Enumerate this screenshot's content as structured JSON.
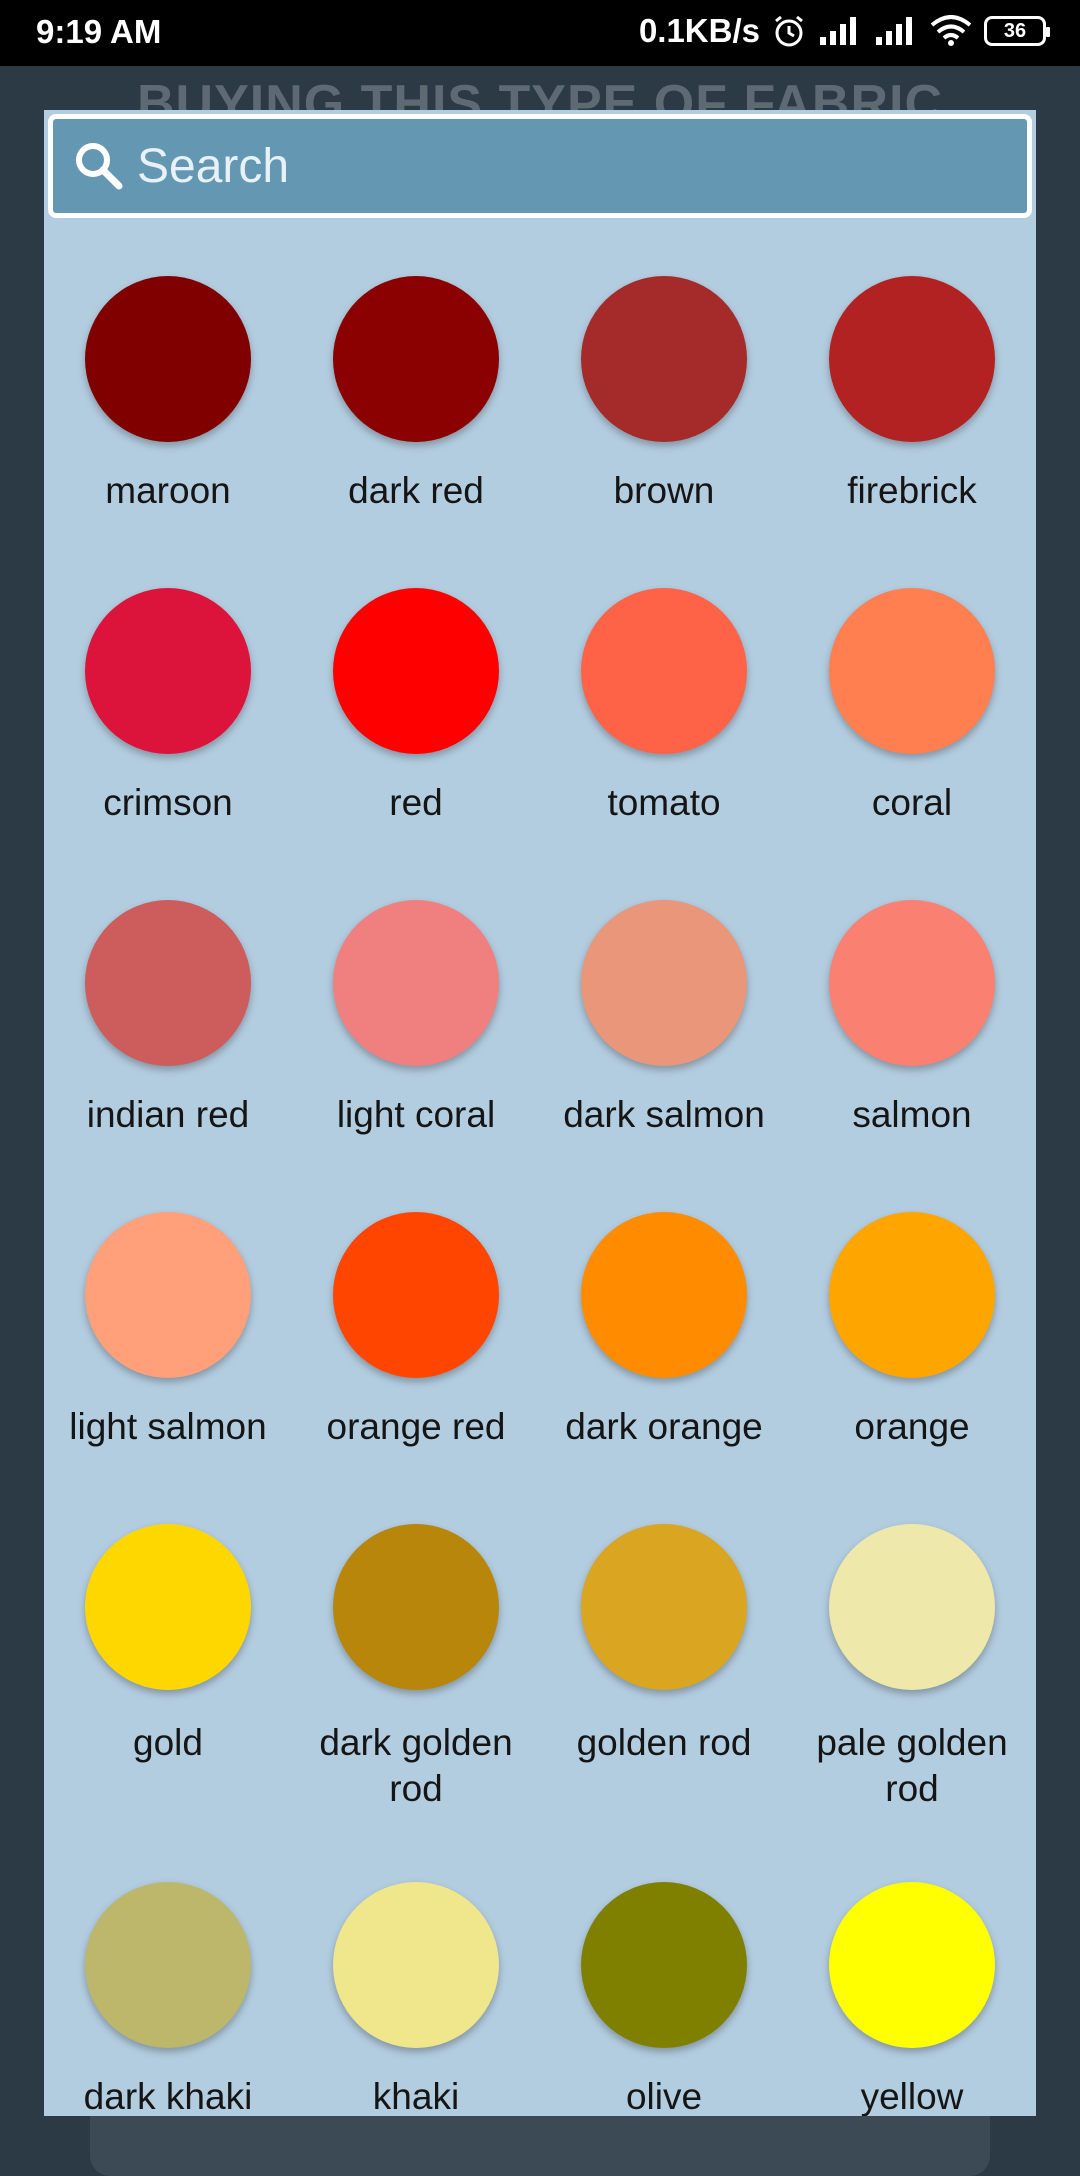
{
  "status_bar": {
    "time": "9:19 AM",
    "network_speed": "0.1KB/s",
    "battery": "36"
  },
  "background": {
    "title": "BUYING THIS TYPE OF FABRIC"
  },
  "search": {
    "placeholder": "Search",
    "value": ""
  },
  "colors": [
    {
      "name": "maroon",
      "hex": "#800000"
    },
    {
      "name": "dark red",
      "hex": "#8B0000"
    },
    {
      "name": "brown",
      "hex": "#A52A2A"
    },
    {
      "name": "firebrick",
      "hex": "#B22222"
    },
    {
      "name": "crimson",
      "hex": "#DC143C"
    },
    {
      "name": "red",
      "hex": "#FF0000"
    },
    {
      "name": "tomato",
      "hex": "#FF6347"
    },
    {
      "name": "coral",
      "hex": "#FF7F50"
    },
    {
      "name": "indian red",
      "hex": "#CD5C5C"
    },
    {
      "name": "light coral",
      "hex": "#F08080"
    },
    {
      "name": "dark salmon",
      "hex": "#E9967A"
    },
    {
      "name": "salmon",
      "hex": "#FA8072"
    },
    {
      "name": "light salmon",
      "hex": "#FFA07A"
    },
    {
      "name": "orange red",
      "hex": "#FF4500"
    },
    {
      "name": "dark orange",
      "hex": "#FF8C00"
    },
    {
      "name": "orange",
      "hex": "#FFA500"
    },
    {
      "name": "gold",
      "hex": "#FFD700"
    },
    {
      "name": "dark golden rod",
      "hex": "#B8860B"
    },
    {
      "name": "golden rod",
      "hex": "#DAA520"
    },
    {
      "name": "pale golden rod",
      "hex": "#EEE8AA"
    },
    {
      "name": "dark khaki",
      "hex": "#BDB76B"
    },
    {
      "name": "khaki",
      "hex": "#F0E68C"
    },
    {
      "name": "olive",
      "hex": "#808000"
    },
    {
      "name": "yellow",
      "hex": "#FFFF00"
    }
  ]
}
